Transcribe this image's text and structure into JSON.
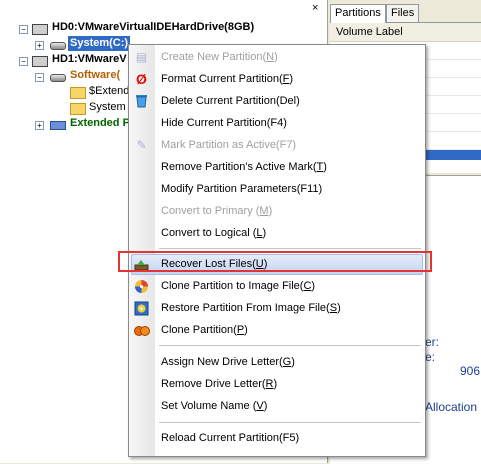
{
  "tree": {
    "close_glyph": "×",
    "disk0_label": "HD0:VMwareVirtualIDEHardDrive(8GB)",
    "disk0_partition": "System(C:)",
    "disk1_label": "HD1:VMwareV",
    "disk1_partition": "Software(",
    "folder1": "$Extend",
    "folder2": "System V",
    "extended": "Extended P"
  },
  "right": {
    "tab_partitions": "Partitions",
    "tab_files": "Files",
    "column_header": "Volume Label",
    "detail_er": "er:",
    "detail_e": "e:",
    "detail_num": "906",
    "detail_alloc": "Allocation"
  },
  "menu": {
    "items": [
      {
        "label": "Create New Partition(",
        "key": "N",
        "suffix": ")",
        "icon": "create-partition-icon",
        "disabled": true
      },
      {
        "label": "Format Current Partition(",
        "key": "F",
        "suffix": ")",
        "icon": "format-icon",
        "disabled": false
      },
      {
        "label": "Delete Current Partition(Del)",
        "key": "",
        "suffix": "",
        "icon": "delete-icon",
        "disabled": false
      },
      {
        "label": "Hide Current Partition(F4)",
        "key": "",
        "suffix": "",
        "icon": "",
        "disabled": false
      },
      {
        "label": "Mark Partition as Active(F7)",
        "key": "",
        "suffix": "",
        "icon": "mark-active-icon",
        "disabled": true
      },
      {
        "label": "Remove Partition's Active Mark(",
        "key": "T",
        "suffix": ")",
        "icon": "",
        "disabled": false
      },
      {
        "label": "Modify Partition Parameters(F11)",
        "key": "",
        "suffix": "",
        "icon": "",
        "disabled": false
      },
      {
        "label": "Convert to Primary (",
        "key": "M",
        "suffix": ")",
        "icon": "",
        "disabled": true
      },
      {
        "label": "Convert to Logical (",
        "key": "L",
        "suffix": ")",
        "icon": "",
        "disabled": false
      },
      {
        "label": "Recover Lost Files(",
        "key": "U",
        "suffix": ")",
        "icon": "recover-files-icon",
        "disabled": false
      },
      {
        "label": "Clone Partition to Image File(",
        "key": "C",
        "suffix": ")",
        "icon": "clone-to-image-icon",
        "disabled": false
      },
      {
        "label": "Restore Partition From Image File(",
        "key": "S",
        "suffix": ")",
        "icon": "restore-image-icon",
        "disabled": false
      },
      {
        "label": "Clone Partition(",
        "key": "P",
        "suffix": ")",
        "icon": "clone-partition-icon",
        "disabled": false
      },
      {
        "label": "Assign New Drive Letter(",
        "key": "G",
        "suffix": ")",
        "icon": "",
        "disabled": false
      },
      {
        "label": "Remove Drive Letter(",
        "key": "R",
        "suffix": ")",
        "icon": "",
        "disabled": false
      },
      {
        "label": "Set Volume Name (",
        "key": "V",
        "suffix": ")",
        "icon": "",
        "disabled": false
      },
      {
        "label": "Reload Current Partition(F5)",
        "key": "",
        "suffix": "",
        "icon": "",
        "disabled": false
      }
    ]
  },
  "colors": {
    "selection": "#316ac5",
    "highlight_box": "#e53333",
    "disabled_text": "#9f9f9f"
  }
}
